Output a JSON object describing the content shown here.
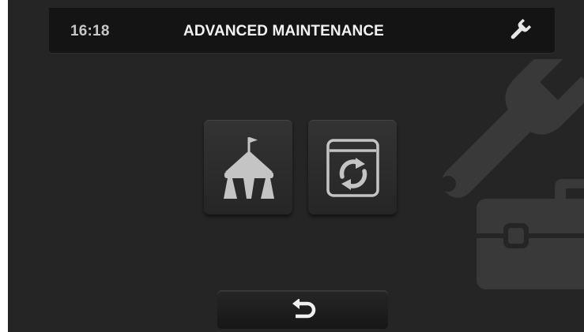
{
  "header": {
    "time": "16:18",
    "title": "ADVANCED MAINTENANCE",
    "icon": "wrench-icon"
  },
  "background": {
    "icons": [
      "wrench-icon",
      "toolbox-icon"
    ]
  },
  "tiles": [
    {
      "icon": "circus-tent-icon"
    },
    {
      "icon": "refresh-panel-icon"
    }
  ],
  "footer": {
    "back_icon": "undo-arrow-icon"
  },
  "colors": {
    "screen_bg": "#252525",
    "header_bg": "#141414",
    "icon_gray": "#c4c4c4",
    "watermark": "#393939",
    "title_text": "#f2f2f2"
  }
}
